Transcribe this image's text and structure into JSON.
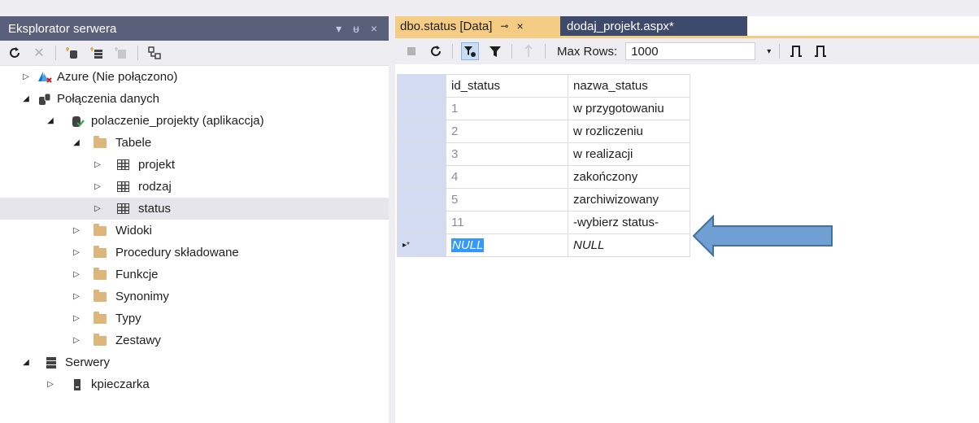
{
  "left_panel": {
    "title": "Eksplorator serwera",
    "title_buttons": [
      "▾",
      "ᵾ",
      "×"
    ],
    "tree": [
      {
        "label": "Azure (Nie połączono)",
        "level": 0,
        "expander": "▷",
        "icon": "azure-icon"
      },
      {
        "label": "Połączenia danych",
        "level": 0,
        "expander": "◢",
        "icon": "data-connections-icon"
      },
      {
        "label": "polaczenie_projekty (aplikaccja)",
        "level": 1,
        "expander": "◢",
        "icon": "database-icon"
      },
      {
        "label": "Tabele",
        "level": 2,
        "expander": "◢",
        "icon": "folder-icon"
      },
      {
        "label": "projekt",
        "level": 3,
        "expander": "▷",
        "icon": "table-icon"
      },
      {
        "label": "rodzaj",
        "level": 3,
        "expander": "▷",
        "icon": "table-icon"
      },
      {
        "label": "status",
        "level": 3,
        "expander": "▷",
        "icon": "table-icon",
        "selected": true
      },
      {
        "label": "Widoki",
        "level": 2,
        "expander": "▷",
        "icon": "folder-icon"
      },
      {
        "label": "Procedury składowane",
        "level": 2,
        "expander": "▷",
        "icon": "folder-icon"
      },
      {
        "label": "Funkcje",
        "level": 2,
        "expander": "▷",
        "icon": "folder-icon"
      },
      {
        "label": "Synonimy",
        "level": 2,
        "expander": "▷",
        "icon": "folder-icon"
      },
      {
        "label": "Typy",
        "level": 2,
        "expander": "▷",
        "icon": "folder-icon"
      },
      {
        "label": "Zestawy",
        "level": 2,
        "expander": "▷",
        "icon": "folder-icon"
      },
      {
        "label": "Serwery",
        "level": 0,
        "expander": "◢",
        "icon": "servers-icon"
      },
      {
        "label": "kpieczarka",
        "level": 1,
        "expander": "▷",
        "icon": "server-icon"
      }
    ]
  },
  "tabs": {
    "active": {
      "label": "dbo.status [Data]",
      "pin": "⊸",
      "close": "×"
    },
    "inactive": {
      "label": "dodaj_projekt.aspx*"
    }
  },
  "toolbar": {
    "max_rows_label": "Max Rows:",
    "max_rows_value": "1000"
  },
  "grid": {
    "columns": [
      "id_status",
      "nazwa_status"
    ],
    "rows": [
      [
        "1",
        "w przygotowaniu"
      ],
      [
        "2",
        "w rozliczeniu"
      ],
      [
        "3",
        "w realizacji"
      ],
      [
        "4",
        "zakończony"
      ],
      [
        "5",
        "zarchiwizowany"
      ],
      [
        "11",
        "-wybierz status-"
      ]
    ],
    "new_row": {
      "marker": "▸*",
      "id": "NULL",
      "name": "NULL"
    }
  },
  "colors": {
    "panel_title_bg": "#5a5f7a",
    "active_tab_bg": "#f5cc84",
    "inactive_tab_bg": "#3e4a6c",
    "row_header_bg": "#d3dbf2",
    "arrow_fill": "#6f9fd3",
    "arrow_stroke": "#41719c"
  }
}
